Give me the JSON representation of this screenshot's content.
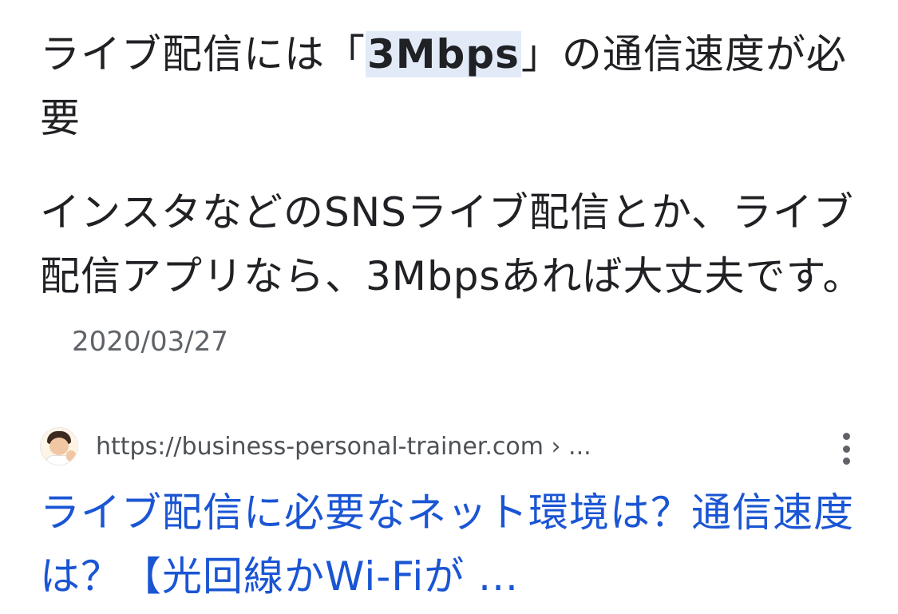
{
  "featured_snippet": {
    "heading_before": "ライブ配信には「",
    "heading_highlight": "3Mbps",
    "heading_after": "」の通信速度が必要",
    "body_text": "インスタなどのSNSライブ配信とか、ライブ配信アプリなら、3Mbpsあれば大丈夫です。",
    "date": "2020/03/27"
  },
  "result": {
    "favicon": "person-avatar-icon",
    "url": "https://business-personal-trainer.com › ...",
    "more_icon": "more-vert-icon",
    "title": "ライブ配信に必要なネット環境は？通信速度は？【光回線かWi-Fiが ..."
  },
  "colors": {
    "highlight_background": "#e2eaf8",
    "link_blue": "#1a55d4",
    "text": "#202124",
    "secondary_text": "#5f6368"
  }
}
